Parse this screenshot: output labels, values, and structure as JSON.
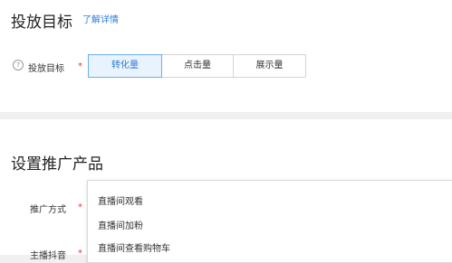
{
  "goal_section": {
    "title": "投放目标",
    "learn_more_link": "了解详情",
    "field_label": "投放目标",
    "required_mark": "*",
    "help_icon": "question-circle-icon",
    "options": [
      {
        "label": "转化量",
        "selected": true
      },
      {
        "label": "点击量",
        "selected": false
      },
      {
        "label": "展示量",
        "selected": false
      }
    ]
  },
  "product_section": {
    "title": "设置推广产品",
    "method_label": "推广方式",
    "anchor_label": "主播抖音",
    "required_mark": "*",
    "dropdown_options": [
      "直播间观看",
      "直播间加粉",
      "直播间查看购物车"
    ]
  },
  "colors": {
    "accent": "#2f7bd9",
    "selected_bg": "#e8f3fd",
    "required": "#e0383e",
    "page_bg": "#f0f0f0"
  }
}
